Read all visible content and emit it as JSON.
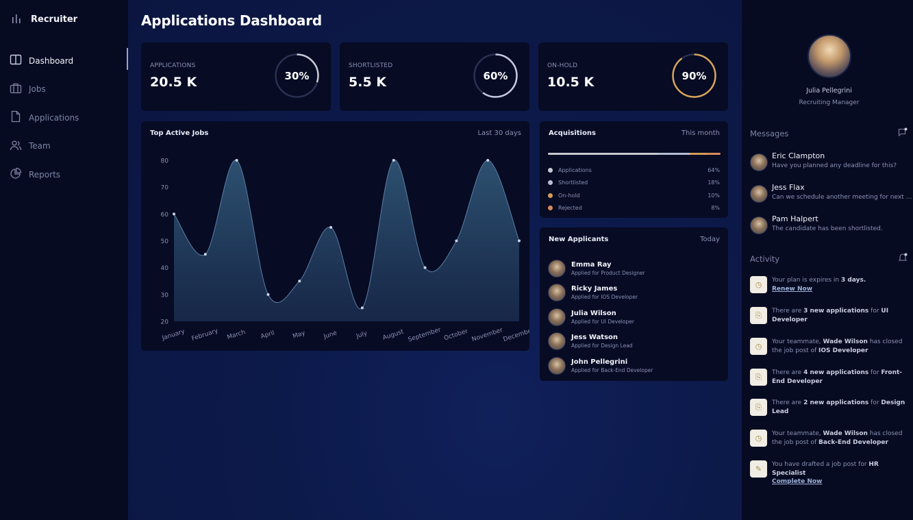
{
  "brand": {
    "name": "Recruiter",
    "icon": "bar-chart-icon"
  },
  "sidebar": {
    "items": [
      {
        "label": "Dashboard",
        "icon": "book-icon",
        "active": true
      },
      {
        "label": "Jobs",
        "icon": "briefcase-icon",
        "active": false
      },
      {
        "label": "Applications",
        "icon": "file-icon",
        "active": false
      },
      {
        "label": "Team",
        "icon": "users-icon",
        "active": false
      },
      {
        "label": "Reports",
        "icon": "pie-chart-icon",
        "active": false
      }
    ]
  },
  "page": {
    "title": "Applications Dashboard"
  },
  "stats": [
    {
      "label": "APPLICATIONS",
      "value": "20.5 K",
      "percent": 30,
      "percent_label": "30%",
      "color": "#c9cbd3"
    },
    {
      "label": "SHORTLISTED",
      "value": "5.5 K",
      "percent": 60,
      "percent_label": "60%",
      "color": "#c3ccdd"
    },
    {
      "label": "ON-HOLD",
      "value": "10.5 K",
      "percent": 90,
      "percent_label": "90%",
      "color": "#d8a458"
    }
  ],
  "top_jobs": {
    "title": "Top Active Jobs",
    "period": "Last 30 days"
  },
  "chart_data": {
    "type": "area",
    "categories": [
      "January",
      "February",
      "March",
      "April",
      "May",
      "June",
      "July",
      "August",
      "September",
      "October",
      "November",
      "December"
    ],
    "values": [
      60,
      45,
      80,
      30,
      35,
      55,
      25,
      80,
      40,
      50,
      80,
      50
    ],
    "ylim": [
      20,
      80
    ],
    "yticks": [
      20,
      30,
      40,
      50,
      60,
      70,
      80
    ],
    "grid": false,
    "fill_color": "#2a4668",
    "line_color": "#5a7fa3"
  },
  "acquisitions": {
    "title": "Acquisitions",
    "period": "This month",
    "items": [
      {
        "label": "Applications",
        "percent": 64,
        "percent_label": "64%",
        "color": "#c7c9d0"
      },
      {
        "label": "Shortlisted",
        "percent": 18,
        "percent_label": "18%",
        "color": "#b5bed3"
      },
      {
        "label": "On-hold",
        "percent": 10,
        "percent_label": "10%",
        "color": "#d59c55"
      },
      {
        "label": "Rejected",
        "percent": 8,
        "percent_label": "8%",
        "color": "#d98a5c"
      }
    ]
  },
  "new_applicants": {
    "title": "New Applicants",
    "period": "Today",
    "items": [
      {
        "name": "Emma Ray",
        "role": "Applied for Product Designer"
      },
      {
        "name": "Ricky James",
        "role": "Applied for IOS Developer"
      },
      {
        "name": "Julia Wilson",
        "role": "Applied for UI Developer"
      },
      {
        "name": "Jess Watson",
        "role": "Applied for Design Lead"
      },
      {
        "name": "John Pellegrini",
        "role": "Applied for Back-End Developer"
      }
    ]
  },
  "profile": {
    "name": "Julia Pellegrini",
    "role": "Recruiting Manager"
  },
  "messages": {
    "title": "Messages",
    "items": [
      {
        "name": "Eric Clampton",
        "text": "Have you planned any deadline for this?"
      },
      {
        "name": "Jess Flax",
        "text": "Can we schedule another meeting for next week?"
      },
      {
        "name": "Pam Halpert",
        "text": "The candidate has been shortlisted."
      }
    ]
  },
  "activity": {
    "title": "Activity",
    "items": [
      {
        "icon": "clock-icon",
        "parts": [
          "Your plan is expires in ",
          "3 days."
        ],
        "link": "Renew Now"
      },
      {
        "icon": "document-icon",
        "parts": [
          "There are ",
          "3 new applications",
          " for ",
          "UI Developer"
        ],
        "link": ""
      },
      {
        "icon": "clock-icon",
        "parts": [
          "Your teammate, ",
          "Wade Wilson",
          " has closed the job post of ",
          "IOS Developer"
        ],
        "link": ""
      },
      {
        "icon": "document-icon",
        "parts": [
          "There are ",
          "4 new applications",
          " for ",
          "Front-End Developer"
        ],
        "link": ""
      },
      {
        "icon": "document-icon",
        "parts": [
          "There are ",
          "2 new applications",
          " for ",
          "Design Lead"
        ],
        "link": ""
      },
      {
        "icon": "clock-icon",
        "parts": [
          "Your teammate, ",
          "Wade Wilson",
          " has closed the job post of ",
          "Back-End Developer"
        ],
        "link": ""
      },
      {
        "icon": "draft-icon",
        "parts": [
          "You have drafted a job post for ",
          "HR Specialist"
        ],
        "link": "Complete Now"
      }
    ]
  }
}
